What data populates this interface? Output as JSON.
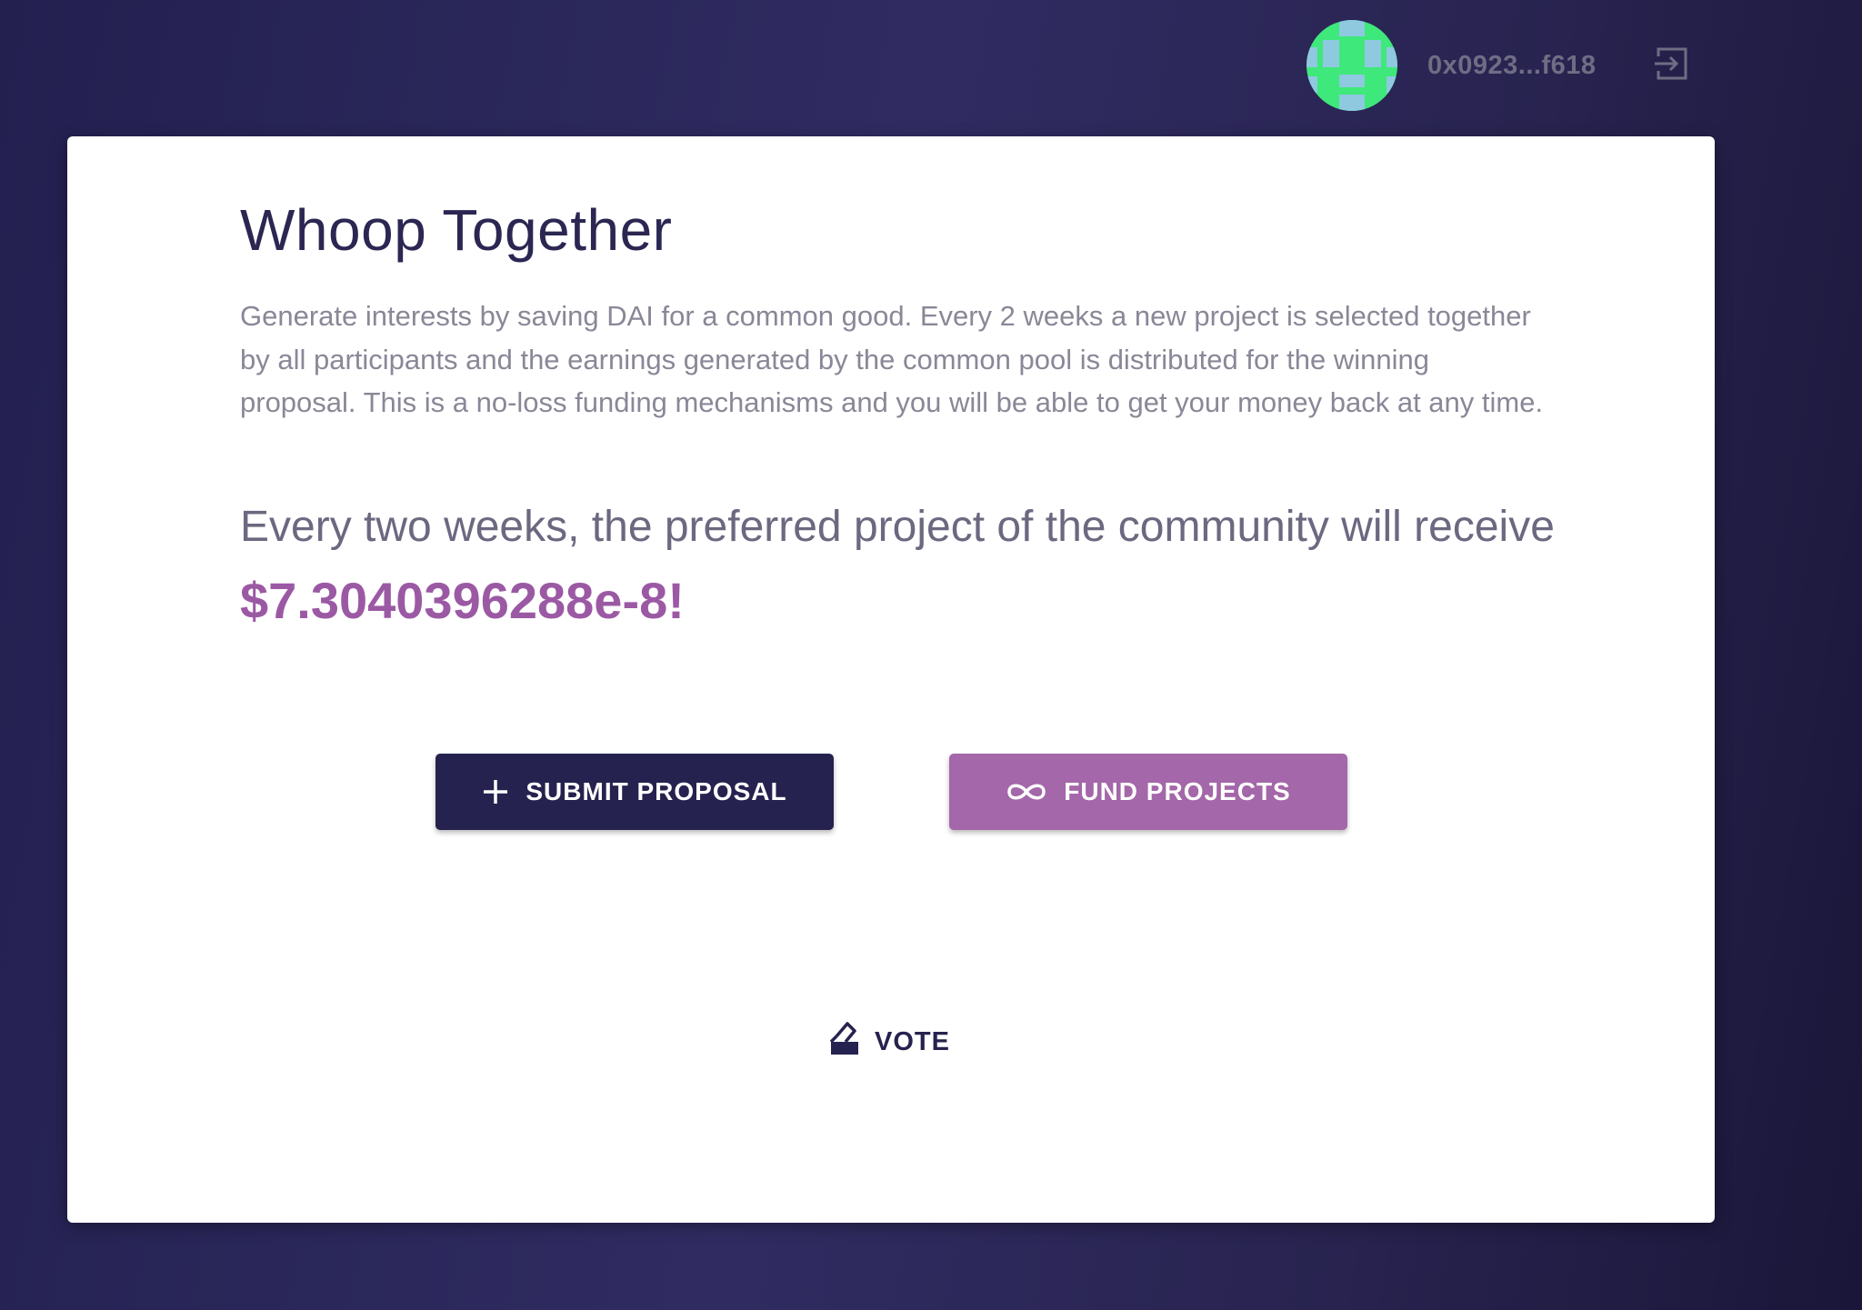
{
  "header": {
    "wallet_address": "0x0923...f618",
    "avatar_icon": "identicon-avatar",
    "logout_icon": "logout-icon",
    "avatar_color": "#3fe87a"
  },
  "main": {
    "title": "Whoop Together",
    "description": "Generate interests by saving DAI for a common good. Every 2 weeks a new project is selected together by all participants and the earnings generated by the common pool is distributed for the winning proposal. This is a no-loss funding mechanisms and you will be able to get your money back at any time.",
    "lead_text": "Every two weeks, the preferred project of the community will receive",
    "amount": "$7.3040396288e-8!"
  },
  "actions": {
    "submit_label": "SUBMIT PROPOSAL",
    "submit_icon": "plus-icon",
    "fund_label": "FUND PROJECTS",
    "fund_icon": "infinity-icon",
    "vote_label": "VOTE",
    "vote_icon": "ballot-box-icon"
  },
  "colors": {
    "primary": "#26224f",
    "accent": "#a467a9",
    "amount": "#9b59a4"
  }
}
